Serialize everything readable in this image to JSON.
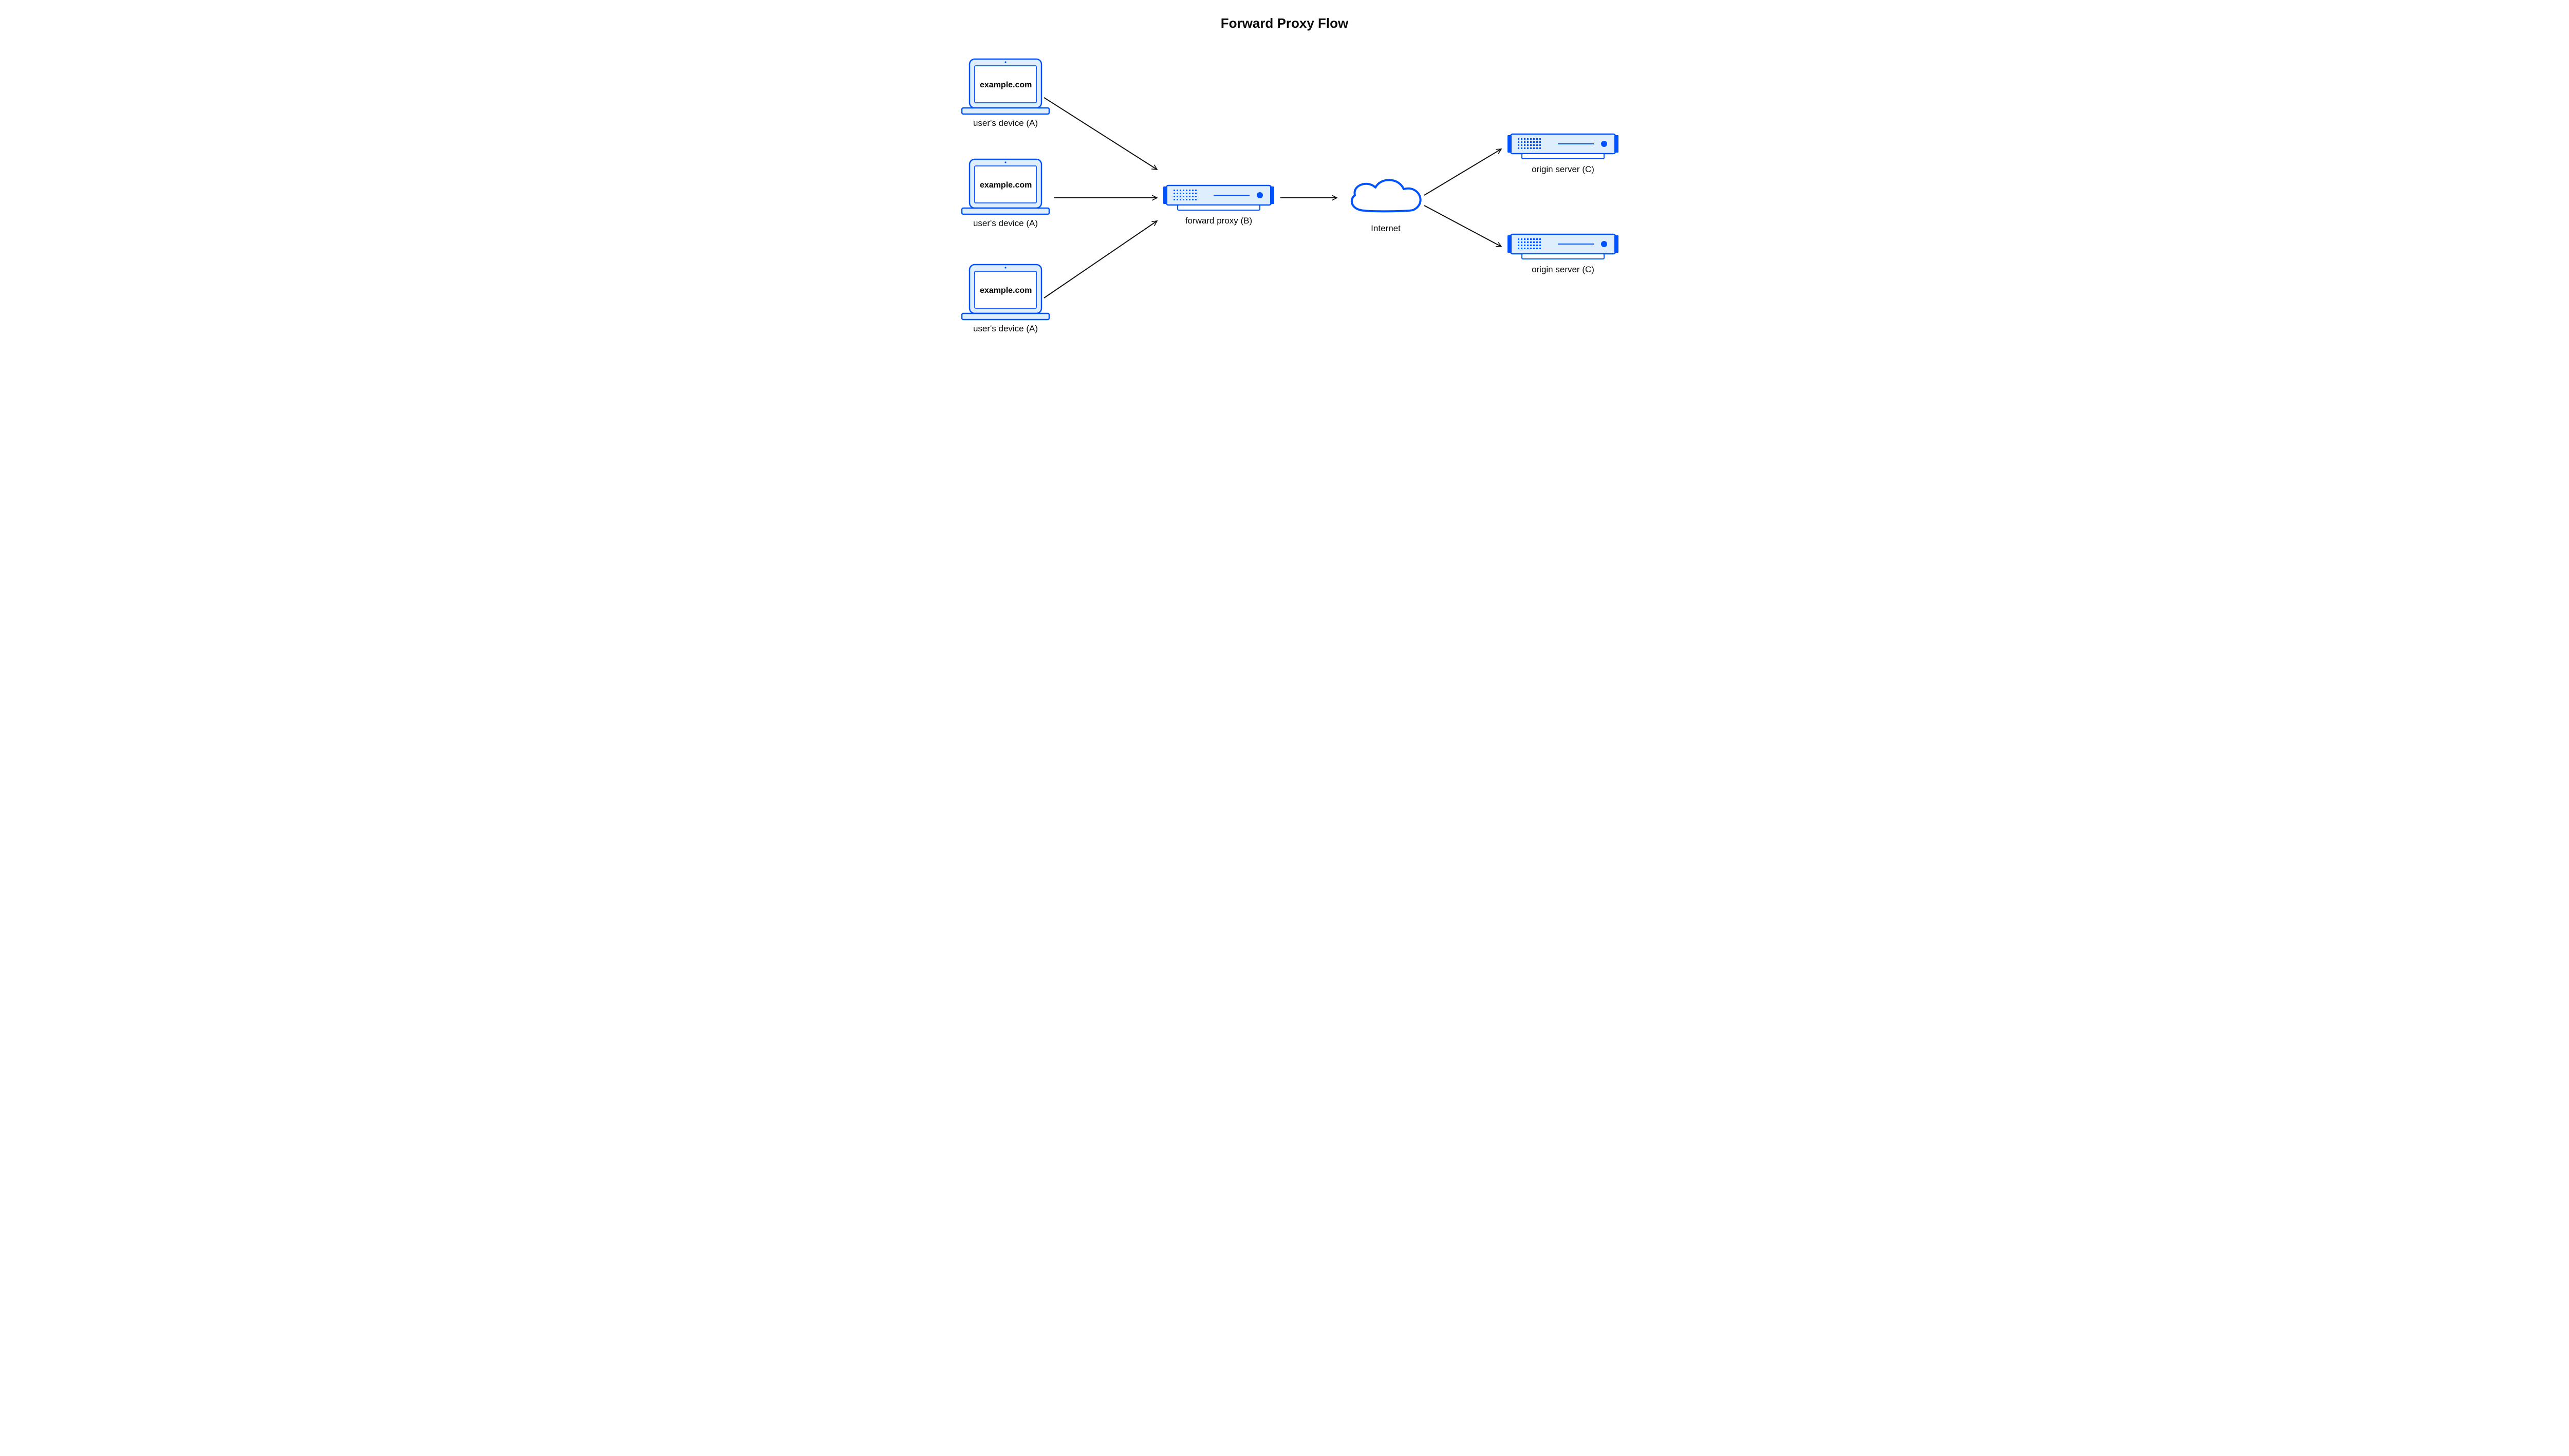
{
  "title": "Forward Proxy Flow",
  "nodes": {
    "user1": {
      "label": "user's device (A)",
      "screen_text": "example.com"
    },
    "user2": {
      "label": "user's device (A)",
      "screen_text": "example.com"
    },
    "user3": {
      "label": "user's device (A)",
      "screen_text": "example.com"
    },
    "proxy": {
      "label": "forward proxy (B)"
    },
    "internet": {
      "label": "Internet"
    },
    "origin1": {
      "label": "origin server (C)"
    },
    "origin2": {
      "label": "origin server (C)"
    }
  },
  "edges": [
    {
      "from": "user1",
      "to": "proxy"
    },
    {
      "from": "user2",
      "to": "proxy"
    },
    {
      "from": "user3",
      "to": "proxy"
    },
    {
      "from": "proxy",
      "to": "internet"
    },
    {
      "from": "internet",
      "to": "origin1"
    },
    {
      "from": "internet",
      "to": "origin2"
    }
  ],
  "colors": {
    "stroke_blue": "#0052ff",
    "fill_light": "#dfeefd",
    "arrow": "#111111"
  }
}
